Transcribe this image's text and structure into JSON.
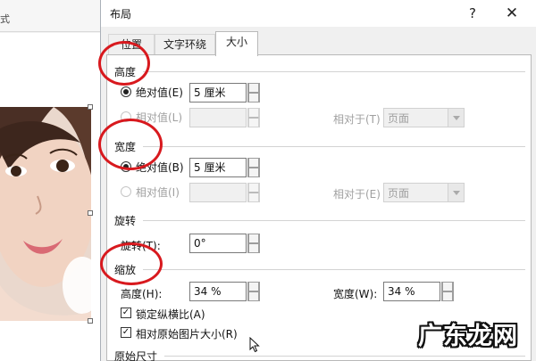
{
  "background_doc": {
    "ribbon_fragment": "式"
  },
  "dialog": {
    "title": "布局",
    "help_label": "?",
    "close_label": "✕",
    "tabs": [
      "位置",
      "文字环绕",
      "大小"
    ],
    "active_tab": "大小"
  },
  "height": {
    "section_title": "高度",
    "absolute_label": "绝对值(E)",
    "absolute_value": "5 厘米",
    "relative_label": "相对值(L)",
    "relative_value": "",
    "relative_to_label": "相对于(T)",
    "relative_to_value": "页面"
  },
  "width": {
    "section_title": "宽度",
    "absolute_label": "绝对值(B)",
    "absolute_value": "5 厘米",
    "relative_label": "相对值(I)",
    "relative_value": "",
    "relative_to_label": "相对于(E)",
    "relative_to_value": "页面"
  },
  "rotation": {
    "section_title": "旋转",
    "label": "旋转(T):",
    "value": "0°"
  },
  "scale": {
    "section_title": "缩放",
    "height_label": "高度(H):",
    "height_value": "34 %",
    "width_label": "宽度(W):",
    "width_value": "34 %",
    "lock_aspect_label": "锁定纵横比(A)",
    "lock_aspect_checked": true,
    "relative_original_label": "相对原始图片大小(R)",
    "relative_original_checked": true
  },
  "original_size": {
    "section_title": "原始尺寸"
  },
  "watermark": "广东龙网",
  "colors": {
    "annotation": "#d8191e",
    "dialog_bg": "#f0f0f0",
    "panel_bg": "#ffffff"
  }
}
